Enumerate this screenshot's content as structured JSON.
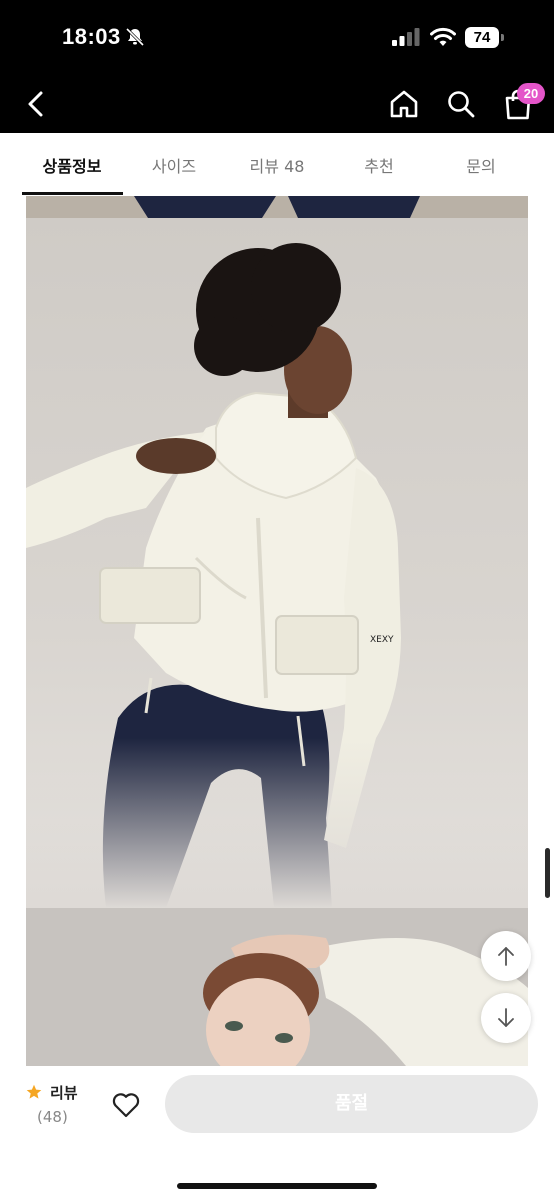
{
  "status_bar": {
    "time": "18:03",
    "battery": "74"
  },
  "header": {
    "cart_count": "20"
  },
  "tabs": [
    {
      "label": "상품정보",
      "active": true
    },
    {
      "label": "사이즈",
      "active": false
    },
    {
      "label": "리뷰 48",
      "active": false
    },
    {
      "label": "추천",
      "active": false
    },
    {
      "label": "문의",
      "active": false
    }
  ],
  "product_images": {
    "sleeve_logo_text": "XEXY",
    "colors": {
      "jacket": "#f3f1e6",
      "leggings": "#1e2540",
      "hair": "#1a1412"
    }
  },
  "bottom_bar": {
    "review_label": "리뷰",
    "review_count": "(48)",
    "buy_button_label": "품절",
    "star_color": "#f5a623"
  }
}
